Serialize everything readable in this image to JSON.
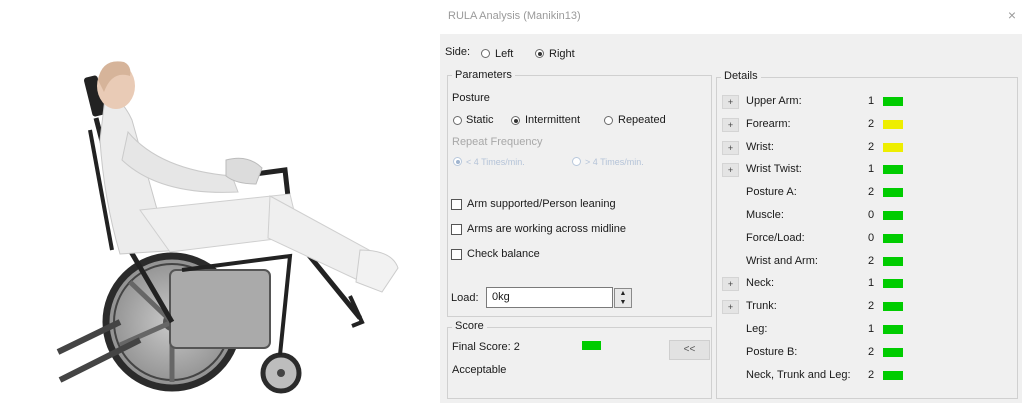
{
  "colors": {
    "green": "#00cc00",
    "yellow": "#eeee00"
  },
  "dialog": {
    "title": "RULA Analysis (Manikin13)",
    "close_glyph": "×"
  },
  "side": {
    "label": "Side:",
    "options": [
      {
        "label": "Left",
        "selected": false
      },
      {
        "label": "Right",
        "selected": true
      }
    ]
  },
  "parameters": {
    "title": "Parameters",
    "posture_label": "Posture",
    "posture_options": [
      {
        "label": "Static",
        "selected": false
      },
      {
        "label": "Intermittent",
        "selected": true
      },
      {
        "label": "Repeated",
        "selected": false
      }
    ],
    "repeat_label": "Repeat Frequency",
    "repeat_options": [
      {
        "label": "< 4 Times/min.",
        "selected": true
      },
      {
        "label": "> 4 Times/min.",
        "selected": false
      }
    ],
    "checkboxes": [
      {
        "label": "Arm supported/Person leaning",
        "checked": false
      },
      {
        "label": "Arms are working across midline",
        "checked": false
      },
      {
        "label": "Check balance",
        "checked": false
      }
    ],
    "load_label": "Load:",
    "load_value": "0kg"
  },
  "score": {
    "title": "Score",
    "final_label": "Final Score: 2",
    "status": "Acceptable",
    "color": "green",
    "toggle_label": "<<"
  },
  "details": {
    "title": "Details",
    "expand_glyph": "+",
    "rows": [
      {
        "label": "Upper Arm:",
        "value": "1",
        "color": "green",
        "expandable": true
      },
      {
        "label": "Forearm:",
        "value": "2",
        "color": "yellow",
        "expandable": true
      },
      {
        "label": "Wrist:",
        "value": "2",
        "color": "yellow",
        "expandable": true
      },
      {
        "label": "Wrist Twist:",
        "value": "1",
        "color": "green",
        "expandable": true
      },
      {
        "label": "Posture A:",
        "value": "2",
        "color": "green",
        "expandable": false
      },
      {
        "label": "Muscle:",
        "value": "0",
        "color": "green",
        "expandable": false
      },
      {
        "label": "Force/Load:",
        "value": "0",
        "color": "green",
        "expandable": false
      },
      {
        "label": "Wrist and Arm:",
        "value": "2",
        "color": "green",
        "expandable": false
      },
      {
        "label": "Neck:",
        "value": "1",
        "color": "green",
        "expandable": true
      },
      {
        "label": "Trunk:",
        "value": "2",
        "color": "green",
        "expandable": true
      },
      {
        "label": "Leg:",
        "value": "1",
        "color": "green",
        "expandable": false
      },
      {
        "label": "Posture B:",
        "value": "2",
        "color": "green",
        "expandable": false
      },
      {
        "label": "Neck, Trunk and Leg:",
        "value": "2",
        "color": "green",
        "expandable": false
      }
    ]
  }
}
